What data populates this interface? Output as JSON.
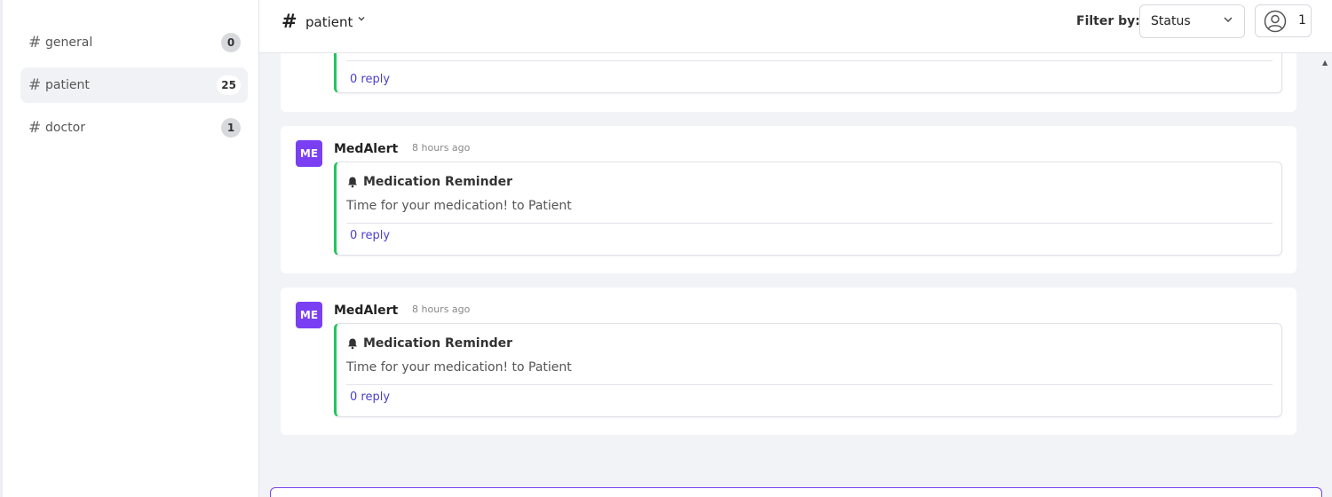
{
  "sidebar": {
    "channels": [
      {
        "hash": "#",
        "label": "general",
        "count": "0"
      },
      {
        "hash": "#",
        "label": "patient",
        "count": "25"
      },
      {
        "hash": "#",
        "label": "doctor",
        "count": "1"
      }
    ]
  },
  "header": {
    "hash": "#",
    "channel": "patient",
    "chevron": "⌄",
    "filter_label": "Filter by:",
    "status_value": "Status",
    "user_count": "1"
  },
  "messages": [
    {
      "reply": "0 reply"
    },
    {
      "avatar": "ME",
      "sender": "MedAlert",
      "time": "8 hours ago",
      "title": "Medication Reminder",
      "body": "Time for your medication! to Patient",
      "reply": "0 reply"
    },
    {
      "avatar": "ME",
      "sender": "MedAlert",
      "time": "8 hours ago",
      "title": "Medication Reminder",
      "body": "Time for your medication! to Patient",
      "reply": "0 reply"
    }
  ],
  "colors": {
    "accent": "#7a3ff2",
    "card_border": "#22c55e",
    "link": "#4a3fc9"
  },
  "icons": {
    "channel": "hash-icon",
    "notification": "bell-icon",
    "user": "user-circle-icon",
    "dropdown": "chevron-down-icon"
  }
}
